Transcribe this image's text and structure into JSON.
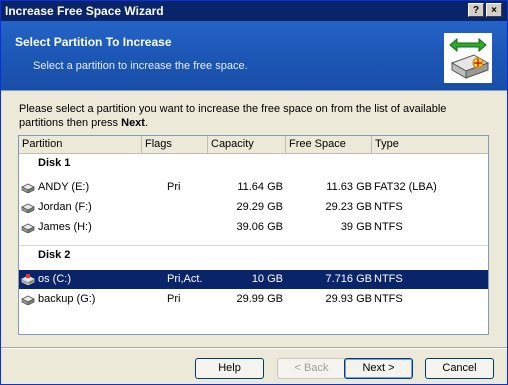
{
  "window": {
    "title": "Increase Free Space Wizard",
    "help_btn": "?",
    "close_btn": "×"
  },
  "header": {
    "title": "Select Partition To Increase",
    "subtitle": "Select a partition to increase the free space."
  },
  "instructions": {
    "text": "Please select a partition you want to increase the free space on from the list of available partitions then press ",
    "emphasis": "Next",
    "end": "."
  },
  "table": {
    "columns": [
      "Partition",
      "Flags",
      "Capacity",
      "Free Space",
      "Type"
    ],
    "disks": [
      {
        "label": "Disk 1",
        "partitions": [
          {
            "name": "ANDY (E:)",
            "flags": "Pri",
            "capacity": "11.64 GB",
            "free": "11.63 GB",
            "type": "FAT32 (LBA)",
            "selected": false
          },
          {
            "name": "Jordan (F:)",
            "flags": "",
            "capacity": "29.29 GB",
            "free": "29.23 GB",
            "type": "NTFS",
            "selected": false
          },
          {
            "name": "James (H:)",
            "flags": "",
            "capacity": "39.06 GB",
            "free": "39 GB",
            "type": "NTFS",
            "selected": false
          }
        ]
      },
      {
        "label": "Disk 2",
        "partitions": [
          {
            "name": "os (C:)",
            "flags": "Pri,Act.",
            "capacity": "10 GB",
            "free": "7.716 GB",
            "type": "NTFS",
            "selected": true
          },
          {
            "name": "backup (G:)",
            "flags": "Pri",
            "capacity": "29.99 GB",
            "free": "29.93 GB",
            "type": "NTFS",
            "selected": false
          }
        ]
      }
    ]
  },
  "buttons": {
    "help": "Help",
    "back": "< Back",
    "next": "Next >",
    "cancel": "Cancel"
  },
  "colors": {
    "title_bar": "#0a246a",
    "header_bg": "#1b55b3",
    "selection": "#0a246a",
    "dialog_bg": "#ece9d8"
  }
}
